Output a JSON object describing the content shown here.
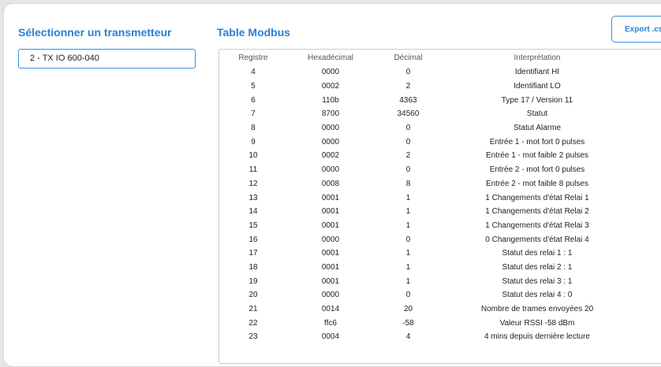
{
  "left_panel": {
    "title": "Sélectionner un transmetteur",
    "selected_transmitter": "2 - TX IO 600-040"
  },
  "right_panel": {
    "title": "Table Modbus",
    "export_label": "Export .csv"
  },
  "table": {
    "columns": [
      "Registre",
      "Hexadécimal",
      "Décimal",
      "Interprétation"
    ],
    "rows": [
      [
        "4",
        "0000",
        "0",
        "Identifiant HI"
      ],
      [
        "5",
        "0002",
        "2",
        "Identifiant LO"
      ],
      [
        "6",
        "110b",
        "4363",
        "Type 17 / Version 11"
      ],
      [
        "7",
        "8700",
        "34560",
        "Statut"
      ],
      [
        "8",
        "0000",
        "0",
        "Statut Alarme"
      ],
      [
        "9",
        "0000",
        "0",
        "Entrée 1 - mot fort 0 pulses"
      ],
      [
        "10",
        "0002",
        "2",
        "Entrée 1 - mot faible 2 pulses"
      ],
      [
        "11",
        "0000",
        "0",
        "Entrée 2 - mot fort 0 pulses"
      ],
      [
        "12",
        "0008",
        "8",
        "Entrée 2 - mot faible 8 pulses"
      ],
      [
        "13",
        "0001",
        "1",
        "1 Changements d'état Relai 1"
      ],
      [
        "14",
        "0001",
        "1",
        "1 Changements d'état Relai 2"
      ],
      [
        "15",
        "0001",
        "1",
        "1 Changements d'état Relai 3"
      ],
      [
        "16",
        "0000",
        "0",
        "0 Changements d'état Relai 4"
      ],
      [
        "17",
        "0001",
        "1",
        "Statut des relai 1 : 1"
      ],
      [
        "18",
        "0001",
        "1",
        "Statut des relai 2 : 1"
      ],
      [
        "19",
        "0001",
        "1",
        "Statut des relai 3 : 1"
      ],
      [
        "20",
        "0000",
        "0",
        "Statut des relai 4 : 0"
      ],
      [
        "21",
        "0014",
        "20",
        "Nombre de trames envoyées 20"
      ],
      [
        "22",
        "ffc6",
        "-58",
        "Valeur RSSI -58 dBm"
      ],
      [
        "23",
        "0004",
        "4",
        "4 mins depuis dernière lecture"
      ]
    ]
  },
  "colors": {
    "accent": "#2a7fd4",
    "background": "#e4e6ea",
    "card": "#ffffff"
  }
}
